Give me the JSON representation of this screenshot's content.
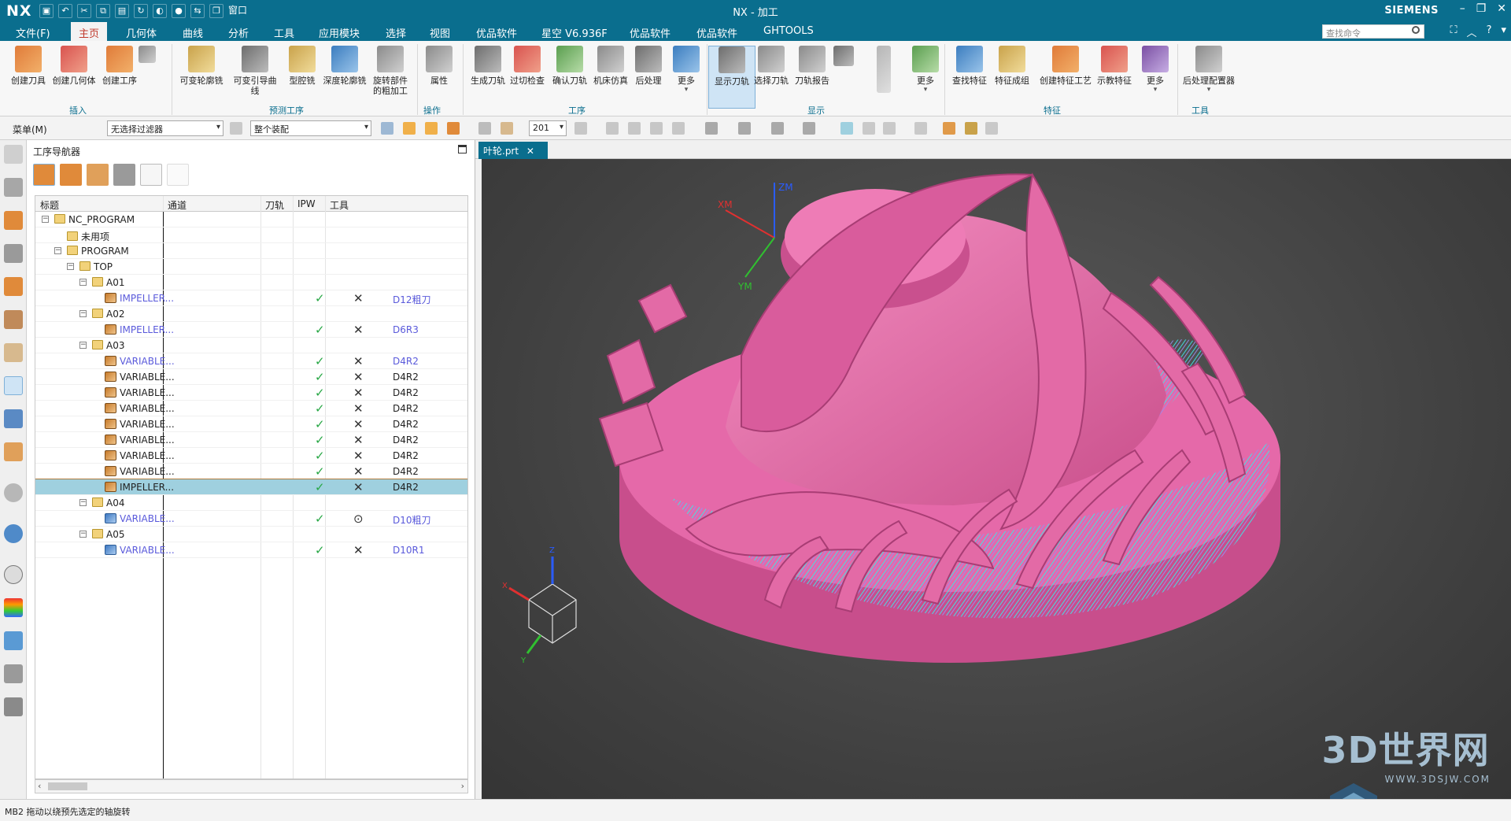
{
  "titlebar": {
    "app_logo": "NX",
    "window_title": "NX - 加工",
    "brand": "SIEMENS",
    "window_menu": "窗口"
  },
  "menubar": {
    "items": [
      "文件(F)",
      "主页",
      "几何体",
      "曲线",
      "分析",
      "工具",
      "应用模块",
      "选择",
      "视图",
      "优品软件",
      "星空 V6.936F",
      "优品软件",
      "优品软件",
      "GHTOOLS"
    ],
    "active_index": 1,
    "search_placeholder": "查找命令"
  },
  "ribbon": {
    "insert": [
      "创建刀具",
      "创建几何体",
      "创建工序"
    ],
    "predict": [
      "可变轮廓铣",
      "可变引导曲线",
      "型腔铣",
      "深度轮廓铣",
      "旋转部件\n的粗加工"
    ],
    "operate": [
      "属性"
    ],
    "procedure": [
      "生成刀轨",
      "过切检查",
      "确认刀轨",
      "机床仿真",
      "后处理",
      "更多"
    ],
    "display": [
      "显示刀轨",
      "选择刀轨",
      "刀轨报告",
      "更多"
    ],
    "feature": [
      "查找特征",
      "特征成组",
      "创建特征工艺",
      "示教特征",
      "更多"
    ],
    "tools": [
      "后处理配置器"
    ],
    "groups": [
      "插入",
      "预测工序",
      "操作",
      "工序",
      "显示",
      "特征",
      "工具"
    ]
  },
  "toolbar2": {
    "menu_label": "菜单(M)",
    "filter": "无选择过滤器",
    "assembly": "整个装配",
    "layer": "201"
  },
  "navigator": {
    "title": "工序导航器",
    "columns": [
      "标题",
      "通道",
      "刀轨",
      "IPW",
      "工具"
    ],
    "rows": [
      {
        "label": "NC_PROGRAM",
        "indent": 0,
        "icon": "folder",
        "exp": "−"
      },
      {
        "label": "未用项",
        "indent": 1,
        "icon": "folder"
      },
      {
        "label": "PROGRAM",
        "indent": 1,
        "icon": "folder",
        "exp": "−"
      },
      {
        "label": "TOP",
        "indent": 2,
        "icon": "folder",
        "exp": "−"
      },
      {
        "label": "A01",
        "indent": 3,
        "icon": "folder",
        "exp": "−"
      },
      {
        "label": "IMPELLER...",
        "indent": 4,
        "icon": "op",
        "link": true,
        "path": "✓",
        "ipw": "✕",
        "tool": "D12粗刀",
        "tool_link": true
      },
      {
        "label": "A02",
        "indent": 3,
        "icon": "folder",
        "exp": "−"
      },
      {
        "label": "IMPELLER...",
        "indent": 4,
        "icon": "op",
        "link": true,
        "path": "✓",
        "ipw": "✕",
        "tool": "D6R3",
        "tool_link": true
      },
      {
        "label": "A03",
        "indent": 3,
        "icon": "folder",
        "exp": "−"
      },
      {
        "label": "VARIABLE...",
        "indent": 4,
        "icon": "op",
        "link": true,
        "path": "✓",
        "ipw": "✕",
        "tool": "D4R2",
        "tool_link": true
      },
      {
        "label": "VARIABLE...",
        "indent": 4,
        "icon": "op",
        "path": "✓",
        "ipw": "✕",
        "tool": "D4R2"
      },
      {
        "label": "VARIABLE...",
        "indent": 4,
        "icon": "op",
        "path": "✓",
        "ipw": "✕",
        "tool": "D4R2"
      },
      {
        "label": "VARIABLE...",
        "indent": 4,
        "icon": "op",
        "path": "✓",
        "ipw": "✕",
        "tool": "D4R2"
      },
      {
        "label": "VARIABLE...",
        "indent": 4,
        "icon": "op",
        "path": "✓",
        "ipw": "✕",
        "tool": "D4R2"
      },
      {
        "label": "VARIABLE...",
        "indent": 4,
        "icon": "op",
        "path": "✓",
        "ipw": "✕",
        "tool": "D4R2"
      },
      {
        "label": "VARIABLE...",
        "indent": 4,
        "icon": "op",
        "path": "✓",
        "ipw": "✕",
        "tool": "D4R2"
      },
      {
        "label": "VARIABLE...",
        "indent": 4,
        "icon": "op",
        "path": "✓",
        "ipw": "✕",
        "tool": "D4R2",
        "hl": true
      },
      {
        "label": "IMPELLER...",
        "indent": 4,
        "icon": "op",
        "path": "✓",
        "ipw": "✕",
        "tool": "D4R2",
        "sel": true
      },
      {
        "label": "A04",
        "indent": 3,
        "icon": "folder",
        "exp": "−"
      },
      {
        "label": "VARIABLE...",
        "indent": 4,
        "icon": "op2",
        "link": true,
        "path": "✓",
        "ipw": "⊙",
        "tool": "D10粗刀",
        "tool_link": true
      },
      {
        "label": "A05",
        "indent": 3,
        "icon": "folder",
        "exp": "−"
      },
      {
        "label": "VARIABLE...",
        "indent": 4,
        "icon": "op2",
        "link": true,
        "path": "✓",
        "ipw": "✕",
        "tool": "D10R1",
        "tool_link": true
      }
    ]
  },
  "viewport": {
    "tab_label": "叶轮.prt",
    "axis_labels": {
      "zm": "ZM",
      "xm": "XM",
      "ym": "YM",
      "x": "X",
      "y": "Y",
      "z": "Z"
    },
    "colors": {
      "part": "#e86aa8",
      "toolpath": "#3fe6e6",
      "background": "#4a4a4a"
    }
  },
  "watermark": {
    "main": "3D世界网",
    "sub": "WWW.3DSJW.COM"
  },
  "status": {
    "text": "MB2 拖动以绕预先选定的轴旋转"
  }
}
